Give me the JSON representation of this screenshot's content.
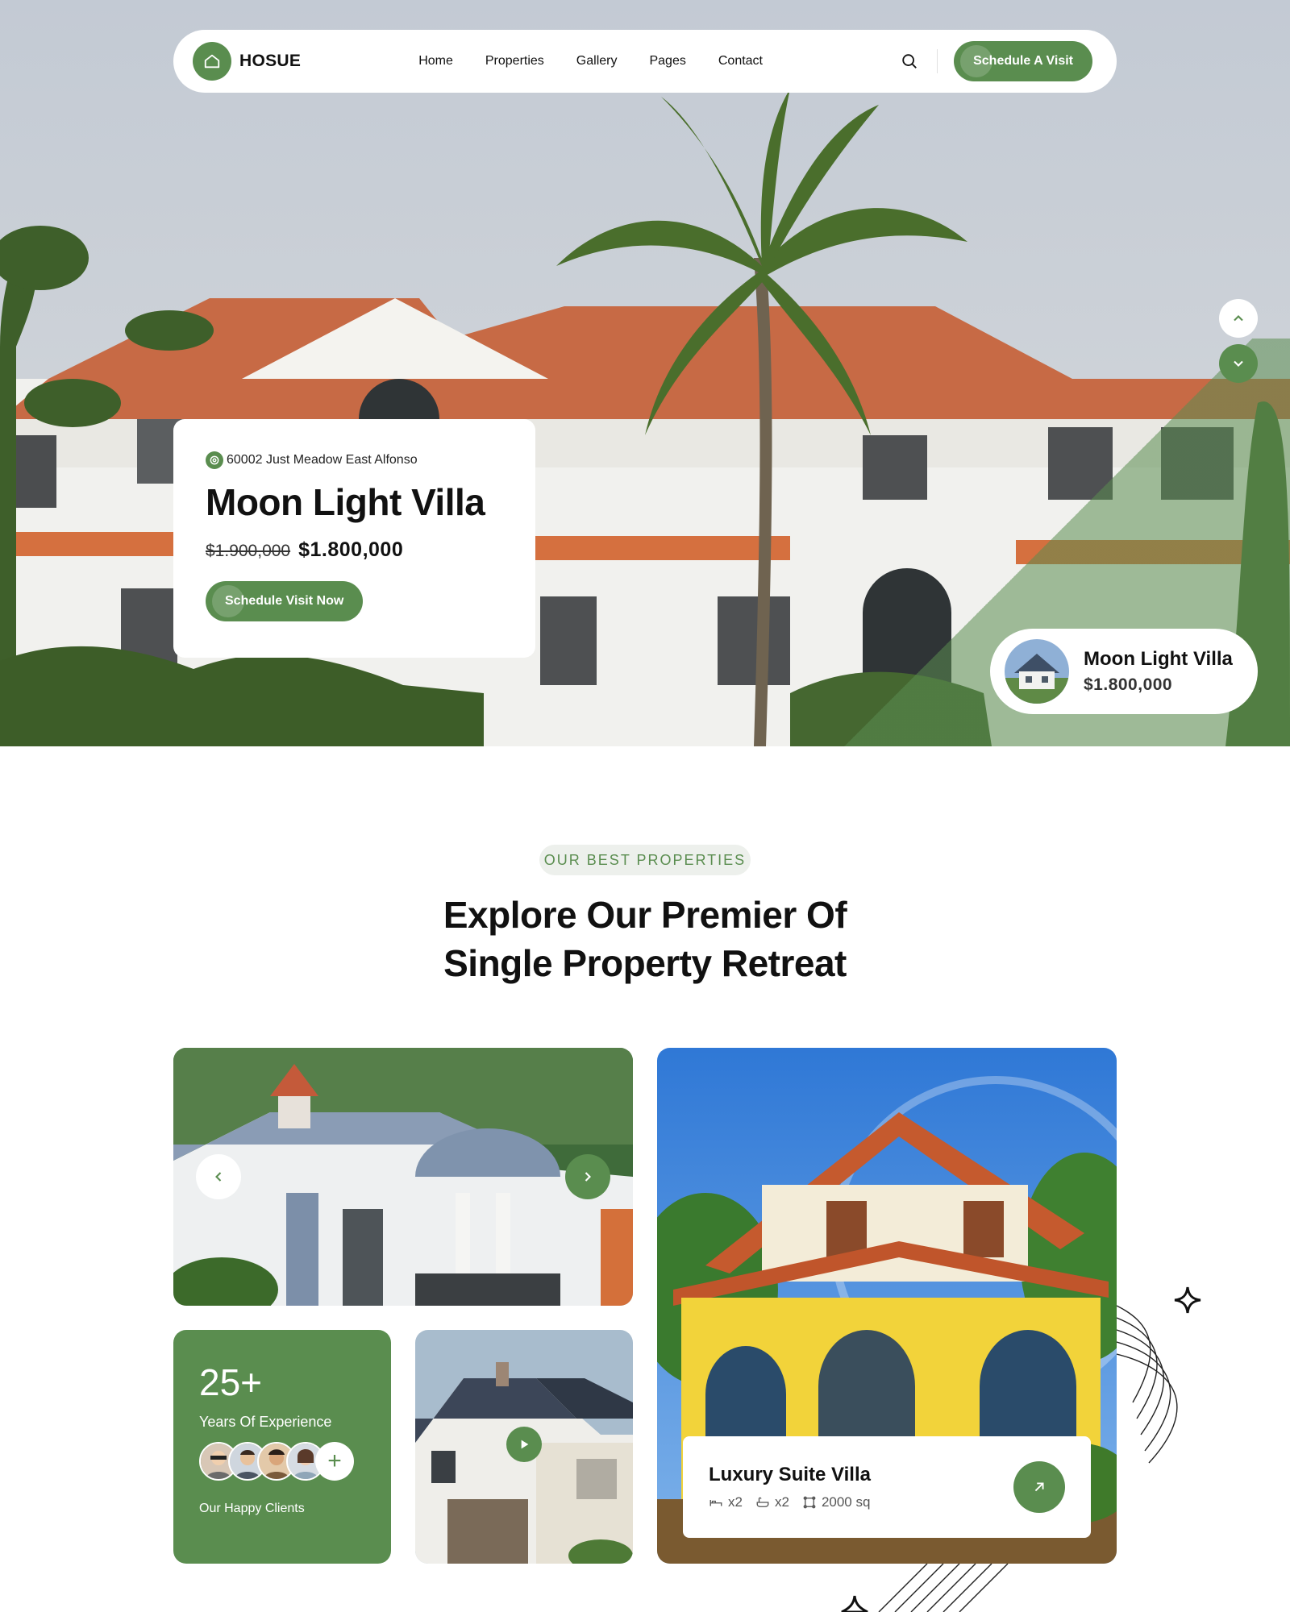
{
  "nav": {
    "brand": "HOSUE",
    "links": [
      "Home",
      "Properties",
      "Gallery",
      "Pages",
      "Contact"
    ],
    "cta": "Schedule A Visit"
  },
  "hero": {
    "address": "60002 Just Meadow East Alfonso",
    "title": "Moon Light Villa",
    "old_price": "$1.900,000",
    "price": "$1.800,000",
    "cta": "Schedule Visit Now",
    "mini_card": {
      "title": "Moon Light Villa",
      "price": "$1.800,000"
    }
  },
  "section": {
    "badge": "OUR BEST PROPERTIES",
    "title_line1": "Explore Our Premier Of",
    "title_line2": "Single Property Retreat"
  },
  "experience": {
    "number": "25+",
    "label": "Years Of Experience",
    "plus": "+",
    "clients_label": "Our Happy Clients"
  },
  "villa": {
    "title": "Luxury Suite Villa",
    "beds": "x2",
    "baths": "x2",
    "area": "2000 sq"
  },
  "colors": {
    "accent": "#5a8d4f",
    "badge_bg": "#edf0ec"
  }
}
